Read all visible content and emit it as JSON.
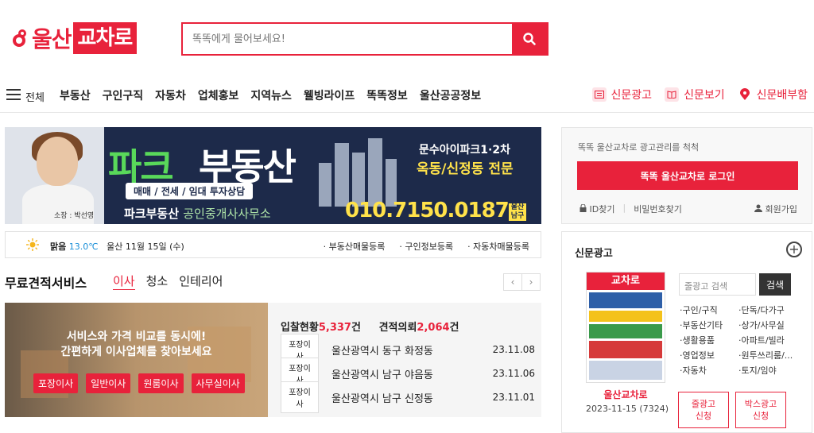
{
  "header": {
    "logo_text": "울산",
    "logo_box": "교차로",
    "search_placeholder": "똑똑에게 물어보세요!"
  },
  "nav": {
    "all": "전체",
    "items": [
      "부동산",
      "구인구직",
      "자동차",
      "업체홍보",
      "지역뉴스",
      "웰빙라이프",
      "똑똑정보",
      "울산공공정보"
    ],
    "right": [
      {
        "label": "신문광고",
        "icon": "newspaper-ad-icon"
      },
      {
        "label": "신문보기",
        "icon": "book-icon"
      },
      {
        "label": "신문배부함",
        "icon": "location-pin-icon"
      }
    ]
  },
  "banner": {
    "headline_a": "파크",
    "headline_b": "부동산",
    "services": "매매 / 전세 / 임대 투자상담",
    "office": "파크부동산",
    "office_suffix": "공인중개사사무소",
    "name": "소장 : 박선영",
    "apt1": "문수아이파크1·2차",
    "apt2": "옥동/신정동 전문",
    "phone": "010.7150.0187",
    "tag": "울산 남구"
  },
  "weather": {
    "condition": "맑음",
    "temp": "13.0℃",
    "date": "울산 11월 15일 (수)",
    "links": [
      "부동산매물등록",
      "구인정보등록",
      "자동차매물등록"
    ]
  },
  "free_quote": {
    "title": "무료견적서비스",
    "tabs": [
      "이사",
      "청소",
      "인테리어"
    ],
    "active_tab": "이사",
    "promo_line1": "서비스와 가격 비교를 동시에!",
    "promo_line2": "간편하게 이사업체를 찾아보세요",
    "promo_buttons": [
      "포장이사",
      "일반이사",
      "원룸이사",
      "사무실이사"
    ],
    "bid_label": "입찰현황",
    "bid_count": "5,337",
    "quote_label": "견적의뢰",
    "quote_count": "2,064",
    "unit": "건",
    "rows": [
      {
        "tag": "포장이사",
        "location": "울산광역시 동구 화정동",
        "date": "23.11.08"
      },
      {
        "tag": "포장이사",
        "location": "울산광역시 남구 야음동",
        "date": "23.11.06"
      },
      {
        "tag": "포장이사",
        "location": "울산광역시 남구 신정동",
        "date": "23.11.01"
      }
    ]
  },
  "login": {
    "message": "똑똑 울산교차로 광고관리를 척척",
    "button": "똑똑 울산교차로 로그인",
    "find_id": "ID찾기",
    "find_pw": "비밀번호찾기",
    "join": "회원가입"
  },
  "newspaper_ad": {
    "title": "신문광고",
    "paper_name": "울산교차로",
    "paper_date": "2023-11-15 (7324)",
    "search_placeholder": "줄광고 검색",
    "search_button": "검색",
    "categories": [
      "구인/구직",
      "단독/다가구",
      "부동산기타",
      "상가/사무실",
      "생활용품",
      "아파트/빌라",
      "영업정보",
      "원투쓰리룸/...",
      "자동차",
      "토지/임야"
    ],
    "btn_line_ad_1": "줄광고",
    "btn_line_ad_2": "신청",
    "btn_box_ad_1": "박스광고",
    "btn_box_ad_2": "신청"
  },
  "colors": {
    "accent": "#e8223b",
    "navy": "#1d2a4a",
    "green": "#59d85a",
    "yellow": "#ffe24a"
  }
}
